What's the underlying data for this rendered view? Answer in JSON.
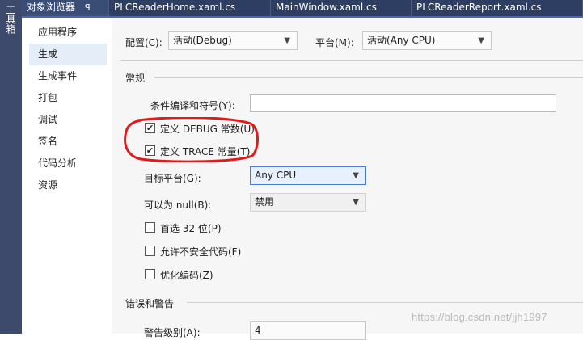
{
  "toolbox": {
    "label": "工具箱"
  },
  "tabs": [
    {
      "label": "对象浏览器",
      "pin": "ꟼ"
    },
    {
      "label": "PLCReaderHome.xaml.cs"
    },
    {
      "label": "MainWindow.xaml.cs"
    },
    {
      "label": "PLCReaderReport.xaml.cs"
    }
  ],
  "sidebar": {
    "items": [
      {
        "label": "应用程序"
      },
      {
        "label": "生成",
        "selected": true
      },
      {
        "label": "生成事件"
      },
      {
        "label": "打包"
      },
      {
        "label": "调试"
      },
      {
        "label": "签名"
      },
      {
        "label": "代码分析"
      },
      {
        "label": "资源"
      }
    ]
  },
  "config": {
    "config_label": "配置(C):",
    "config_value": "活动(Debug)",
    "platform_label": "平台(M):",
    "platform_value": "活动(Any CPU)"
  },
  "general": {
    "title": "常规",
    "symbols_label": "条件编译和符号(Y):",
    "symbols_value": "",
    "define_debug_label": "定义 DEBUG 常数(U)",
    "define_debug_checked": true,
    "define_trace_label": "定义 TRACE 常量(T)",
    "define_trace_checked": true,
    "target_platform_label": "目标平台(G):",
    "target_platform_value": "Any CPU",
    "nullable_label": "可以为 null(B):",
    "nullable_value": "禁用",
    "prefer32_label": "首选 32 位(P)",
    "prefer32_checked": false,
    "unsafe_label": "允许不安全代码(F)",
    "unsafe_checked": false,
    "optimize_label": "优化编码(Z)",
    "optimize_checked": false
  },
  "errors": {
    "title": "错误和警告",
    "warning_level_label": "警告级别(A):",
    "warning_level_value": "4"
  },
  "watermark": "https://blog.csdn.net/jjh1997",
  "colors": {
    "annotation": "#e01b1b",
    "tab_bg": "#2d3e62",
    "selected_nav": "#e5edf8"
  }
}
